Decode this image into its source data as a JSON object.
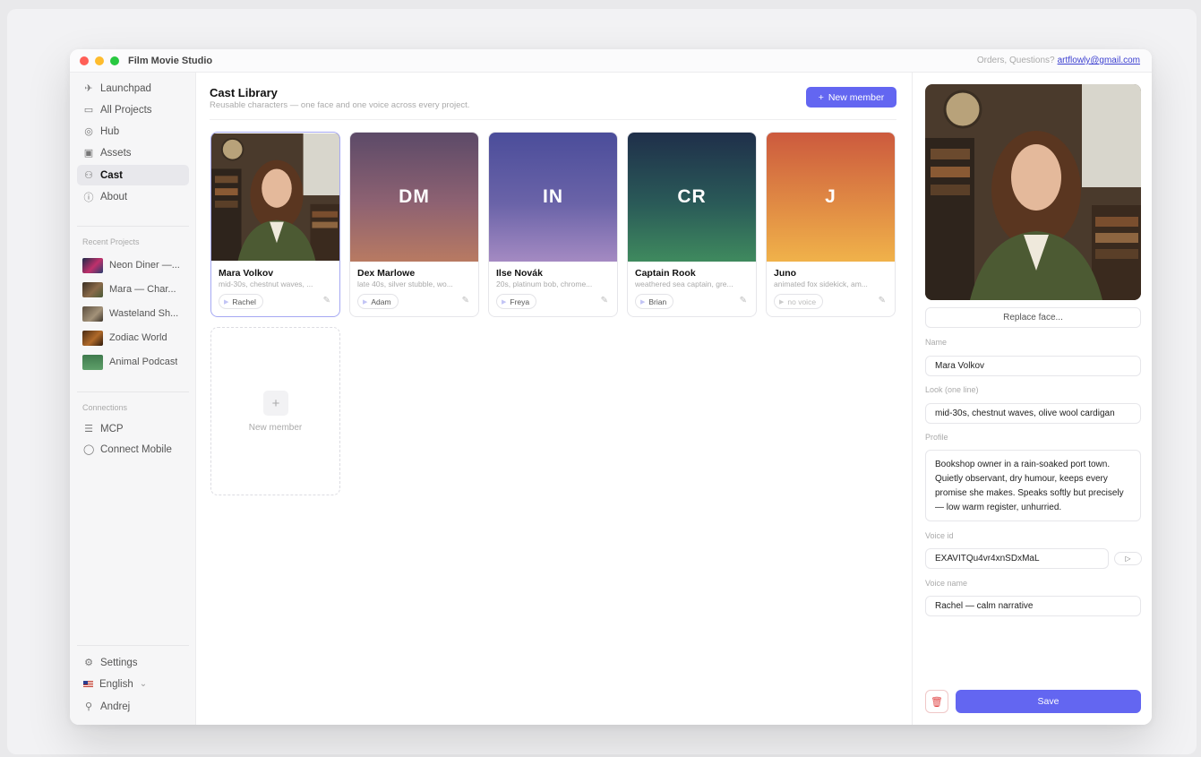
{
  "app": {
    "title": "Film Movie Studio",
    "contact_prefix": "Orders, Questions?",
    "contact_email": "artflowly@gmail.com"
  },
  "colors": {
    "accent": "#6366f1",
    "traffic_red": "#ff5f57",
    "traffic_yellow": "#febc2e",
    "traffic_green": "#28c840"
  },
  "sidebar": {
    "nav": [
      {
        "label": "Launchpad",
        "icon": "rocket-icon",
        "glyph": "✈"
      },
      {
        "label": "All Projects",
        "icon": "folder-icon",
        "glyph": "▭"
      },
      {
        "label": "Hub",
        "icon": "compass-icon",
        "glyph": "◎"
      },
      {
        "label": "Assets",
        "icon": "image-icon",
        "glyph": "▣"
      },
      {
        "label": "Cast",
        "icon": "users-icon",
        "glyph": "⚇"
      },
      {
        "label": "About",
        "icon": "info-icon",
        "glyph": "ⓘ"
      }
    ],
    "recent_label": "Recent Projects",
    "recent_projects": [
      {
        "label": "Neon Diner —..."
      },
      {
        "label": "Mara — Char..."
      },
      {
        "label": "Wasteland Sh..."
      },
      {
        "label": "Zodiac World"
      },
      {
        "label": "Animal Podcast"
      }
    ],
    "connections_label": "Connections",
    "connections": [
      {
        "label": "MCP",
        "icon": "server-icon",
        "glyph": "☰"
      },
      {
        "label": "Connect Mobile",
        "icon": "chat-bubble-icon",
        "glyph": "◯"
      }
    ],
    "settings": "Settings",
    "language": "English",
    "language_chevron": "⌄",
    "user": "Andrej"
  },
  "main": {
    "title": "Cast Library",
    "subtitle": "Reusable characters — one face and one voice across every project.",
    "new_member_button": "New member",
    "new_member_plus": "+",
    "cards": [
      {
        "name": "Mara Volkov",
        "desc": "mid-30s, chestnut waves, ...",
        "voice": "Rachel",
        "initials": ""
      },
      {
        "name": "Dex Marlowe",
        "desc": "late 40s, silver stubble, wo...",
        "voice": "Adam",
        "initials": "DM"
      },
      {
        "name": "Ilse Novák",
        "desc": "20s, platinum bob, chrome...",
        "voice": "Freya",
        "initials": "IN"
      },
      {
        "name": "Captain Rook",
        "desc": "weathered sea captain, gre...",
        "voice": "Brian",
        "initials": "CR"
      },
      {
        "name": "Juno",
        "desc": "animated fox sidekick, am...",
        "voice": "no voice",
        "initials": "J"
      }
    ],
    "new_card_label": "New member",
    "new_card_plus": "+"
  },
  "panel": {
    "replace_face": "Replace face...",
    "name_label": "Name",
    "name_value": "Mara Volkov",
    "look_label": "Look (one line)",
    "look_value": "mid-30s, chestnut waves, olive wool cardigan",
    "profile_label": "Profile",
    "profile_value": "Bookshop owner in a rain-soaked port town. Quietly observant, dry humour, keeps every promise she makes. Speaks softly but precisely — low warm register, unhurried.",
    "voice_id_label": "Voice id",
    "voice_id_value": "EXAVITQu4vr4xnSDxMaL",
    "voice_name_label": "Voice name",
    "voice_name_value": "Rachel — calm narrative",
    "save": "Save"
  }
}
